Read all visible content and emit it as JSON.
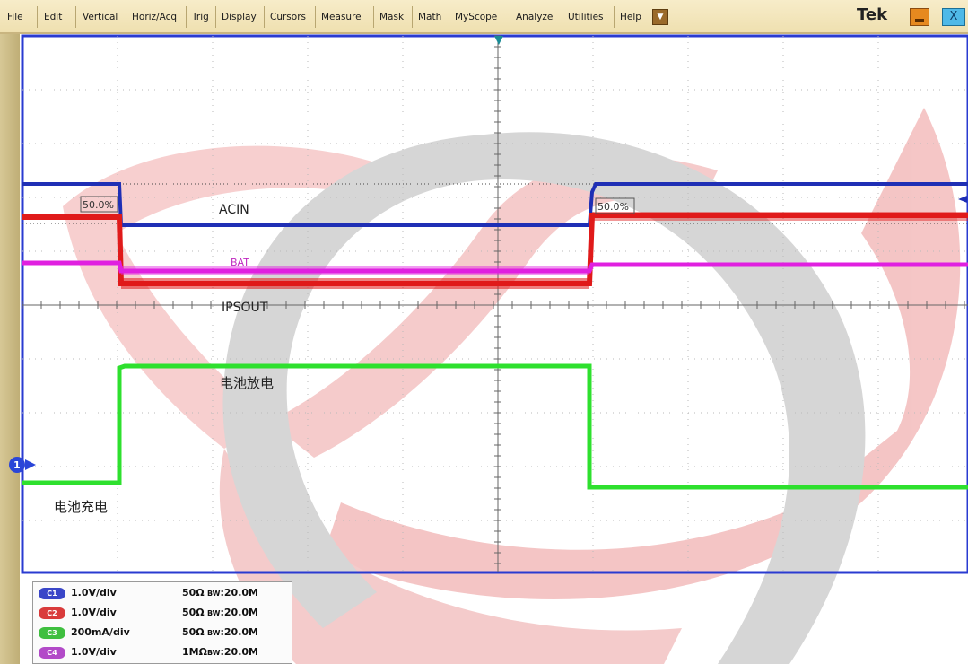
{
  "menu": {
    "items": [
      "File",
      "Edit",
      "Vertical",
      "Horiz/Acq",
      "Trig",
      "Display",
      "Cursors",
      "Measure",
      "Mask",
      "Math",
      "MyScope",
      "Analyze",
      "Utilities",
      "Help"
    ],
    "brand": "Tek",
    "dropdown_icon": "chevron-down-icon",
    "close_label": "X"
  },
  "display": {
    "colors": {
      "grid": "#b9b9b9",
      "c1": "#1f2fb5",
      "c2": "#e01a1a",
      "c3": "#2ee02e",
      "c4": "#e020e0",
      "frame": "#2a3bd1"
    },
    "labels": {
      "acin": "ACIN",
      "bat": "BAT",
      "ipsout": "IPSOUT",
      "discharge": "电池放电",
      "charge": "电池充电",
      "pct_left": "50.0%",
      "pct_right": "50.0%",
      "ch1_marker": "1"
    }
  },
  "channels": [
    {
      "badge": "C1",
      "scale": "1.0V/div",
      "impedance": "50Ω",
      "bw_label": "BW",
      "bw": ":20.0M",
      "color": "#3a46c8"
    },
    {
      "badge": "C2",
      "scale": "1.0V/div",
      "impedance": "50Ω",
      "bw_label": "BW",
      "bw": ":20.0M",
      "color": "#d93b3b"
    },
    {
      "badge": "C3",
      "scale": "200mA/div",
      "impedance": "50Ω",
      "bw_label": "BW",
      "bw": ":20.0M",
      "color": "#3fbf3f"
    },
    {
      "badge": "C4",
      "scale": "1.0V/div",
      "impedance": "1MΩ",
      "bw_label": "BW",
      "bw": ":20.0M",
      "color": "#b24ac8"
    }
  ]
}
